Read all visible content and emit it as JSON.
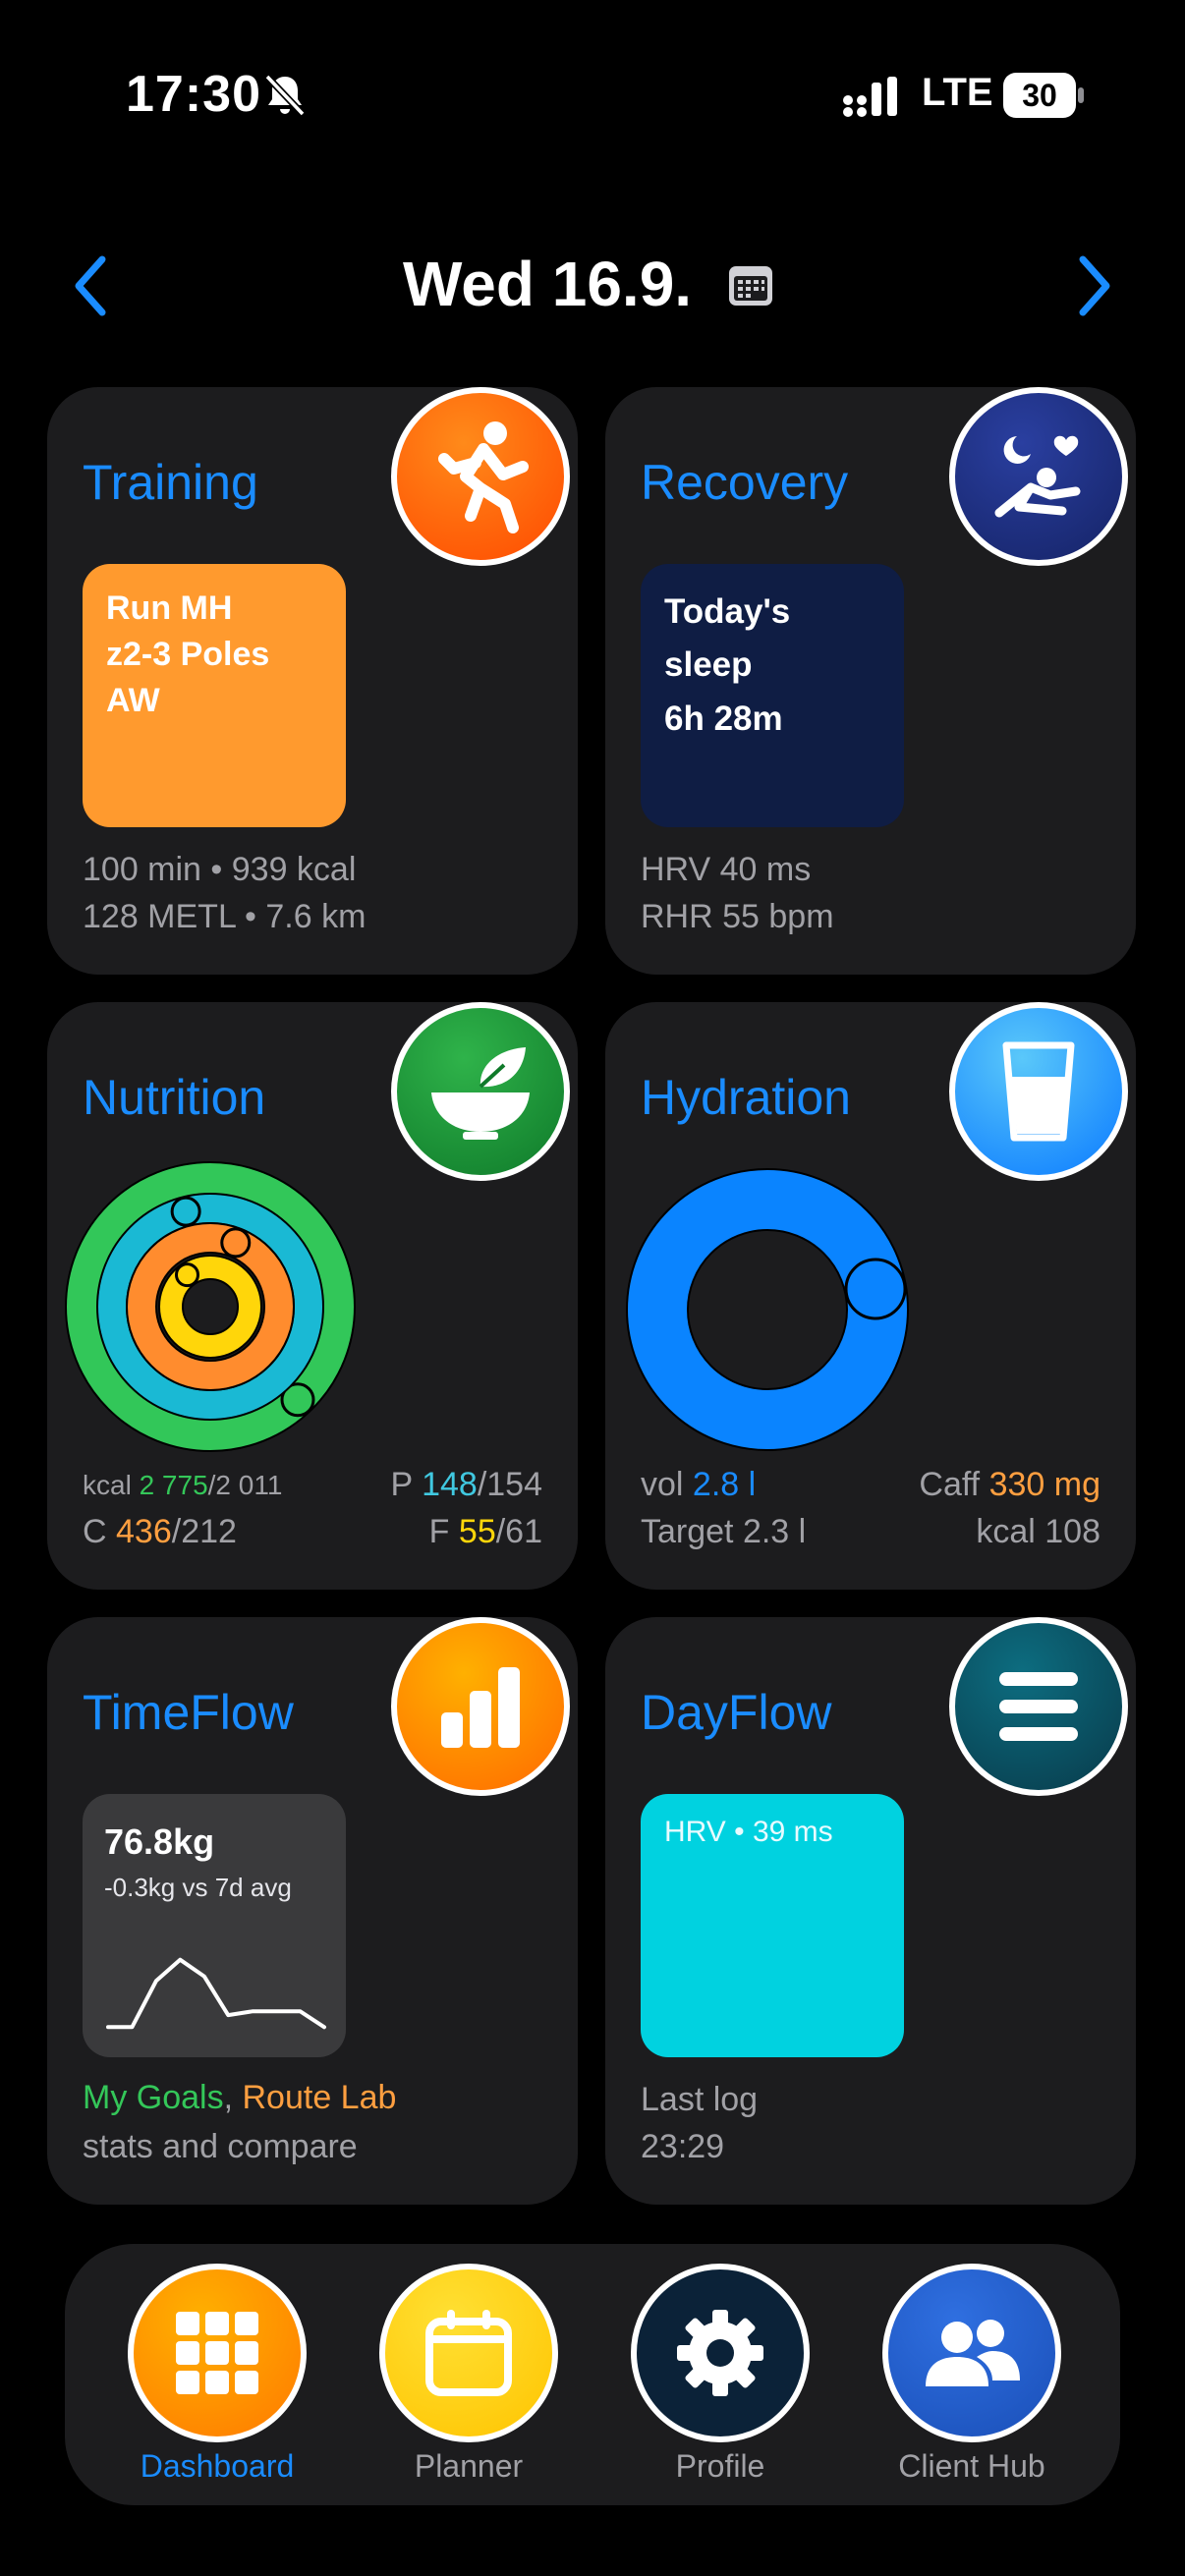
{
  "status_bar": {
    "time": "17:30",
    "network": "LTE",
    "battery": "30"
  },
  "header": {
    "date": "Wed 16.9."
  },
  "cards": {
    "training": {
      "title": "Training",
      "workout": [
        "Run MH",
        "z2-3 Poles",
        "AW"
      ],
      "stats_line1": "100 min • 939 kcal",
      "stats_line2": "128 METL • 7.6 km",
      "tile_color": "#ff9a2e"
    },
    "recovery": {
      "title": "Recovery",
      "sleep": [
        "Today's",
        "sleep",
        "6h 28m"
      ],
      "hrv": "HRV 40 ms",
      "rhr": "RHR 55 bpm",
      "tile_color": "#0f1d44"
    },
    "nutrition": {
      "title": "Nutrition",
      "kcal_label": "kcal",
      "kcal_value": "2 775",
      "kcal_target": "/2 011",
      "p_label": "P",
      "p_value": "148",
      "p_target": "/154",
      "c_label": "C",
      "c_value": "436",
      "c_target": "/212",
      "f_label": "F",
      "f_value": "55",
      "f_target": "/61",
      "rings": [
        {
          "name": "kcal",
          "color": "#32c759",
          "progress": 1.38
        },
        {
          "name": "protein",
          "color": "#1ab9d4",
          "progress": 0.96
        },
        {
          "name": "carbs",
          "color": "#ff8c2e",
          "progress": 2.06
        },
        {
          "name": "fat",
          "color": "#ffd60a",
          "progress": 0.9
        }
      ]
    },
    "hydration": {
      "title": "Hydration",
      "vol_label": "vol",
      "vol_value": "2.8 l",
      "caff_label": "Caff",
      "caff_value": "330 mg",
      "target": "Target 2.3 l",
      "kcal": "kcal 108",
      "ring_color": "#0a84ff",
      "progress": 1.22
    },
    "timeflow": {
      "title": "TimeFlow",
      "weight": "76.8kg",
      "delta": "-0.3kg vs 7d avg",
      "goals": "My Goals",
      "separator": ",",
      "route_lab": "Route Lab",
      "sub": "stats and compare",
      "sparkline": [
        0.05,
        0.05,
        0.55,
        0.78,
        0.6,
        0.18,
        0.22,
        0.22,
        0.22,
        0.05
      ]
    },
    "dayflow": {
      "title": "DayFlow",
      "tile_text": "HRV • 39 ms",
      "last_log_label": "Last log",
      "last_log_time": "23:29",
      "tile_color": "#00d2e0"
    }
  },
  "tabs": [
    {
      "label": "Dashboard",
      "active": true
    },
    {
      "label": "Planner",
      "active": false
    },
    {
      "label": "Profile",
      "active": false
    },
    {
      "label": "Client Hub",
      "active": false
    }
  ],
  "colors": {
    "accent": "#1a8cff",
    "green": "#34c759",
    "cyan": "#40c8e0",
    "orange": "#ff9f40",
    "yellow": "#ffd60a"
  }
}
